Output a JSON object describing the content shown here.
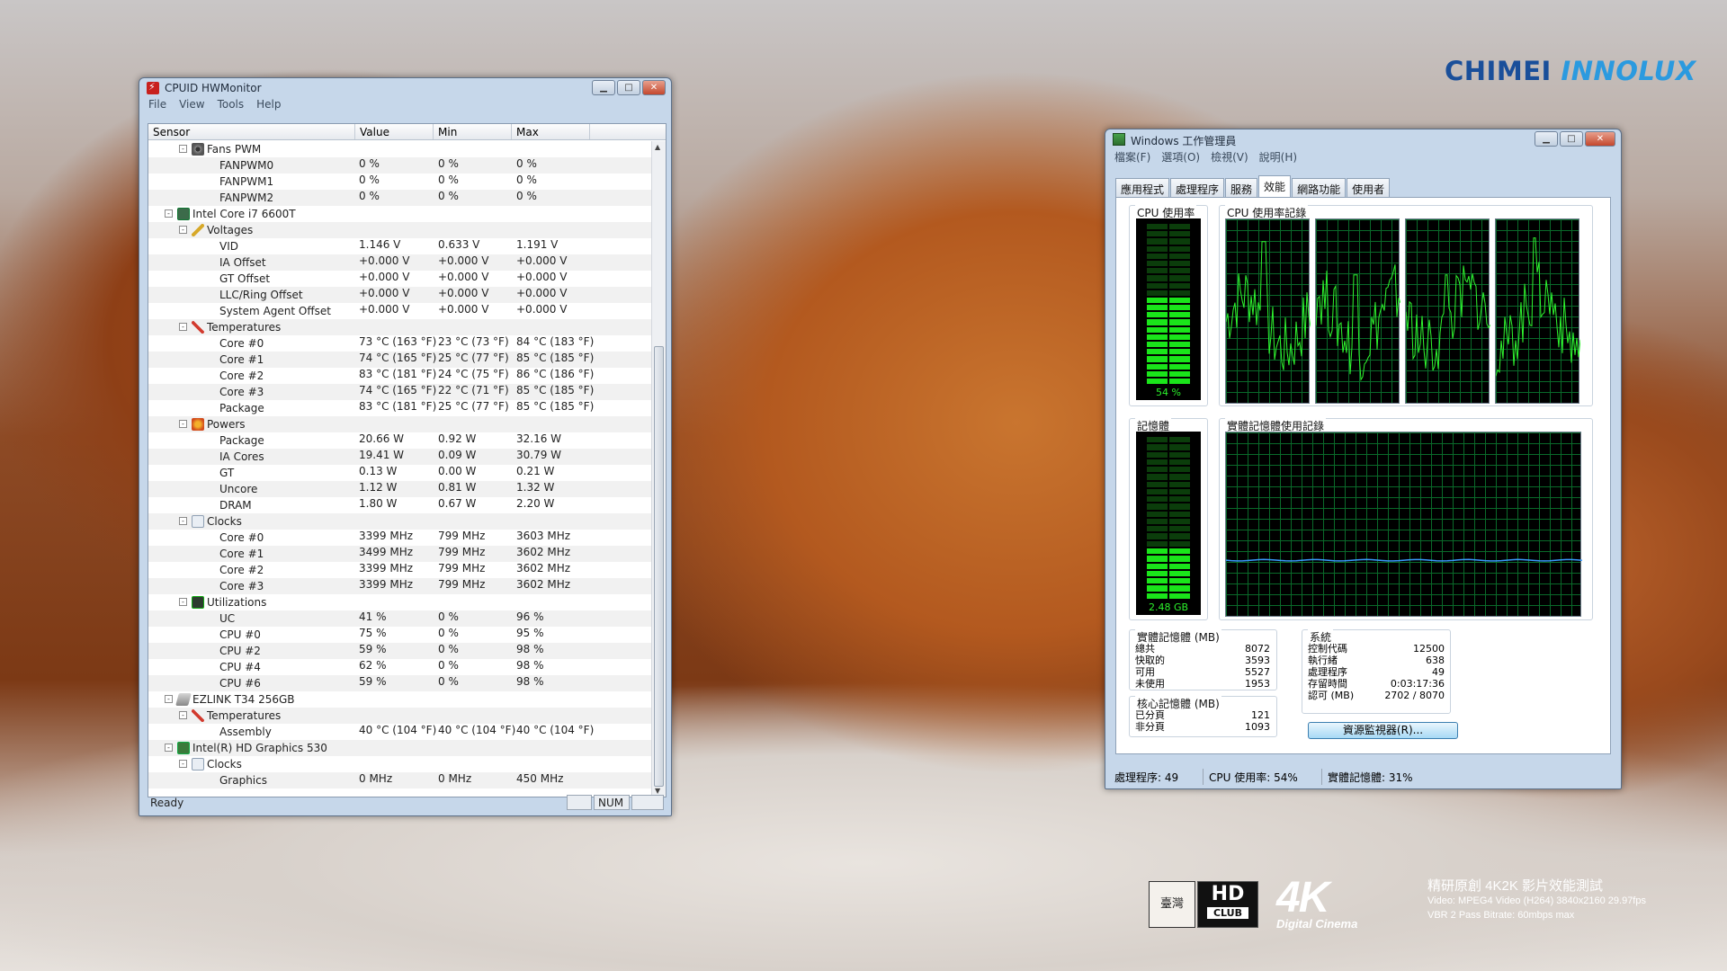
{
  "watermark": {
    "brand_part1": "CHIMEI",
    "brand_part2": "INNOLUX",
    "taiwan_badge": "臺灣",
    "hd_text": "HD",
    "club_text": "CLUB",
    "fourk_big": "4K",
    "fourk_small": "Digital Cinema",
    "line1": "精研原創 4K2K 影片效能測試",
    "line2": "Video: MPEG4 Video (H264) 3840x2160 29.97fps",
    "line3": "VBR 2 Pass Bitrate: 60mbps max"
  },
  "hwmonitor": {
    "title": "CPUID HWMonitor",
    "menu": [
      "File",
      "View",
      "Tools",
      "Help"
    ],
    "columns": [
      "Sensor",
      "Value",
      "Min",
      "Max"
    ],
    "rows": [
      {
        "level": 2,
        "toggle": "-",
        "icon": "fan",
        "name": "Fans PWM",
        "value": "",
        "min": "",
        "max": ""
      },
      {
        "level": 3,
        "name": "FANPWM0",
        "value": "0 %",
        "min": "0 %",
        "max": "0 %"
      },
      {
        "level": 3,
        "name": "FANPWM1",
        "value": "0 %",
        "min": "0 %",
        "max": "0 %"
      },
      {
        "level": 3,
        "name": "FANPWM2",
        "value": "0 %",
        "min": "0 %",
        "max": "0 %"
      },
      {
        "level": 1,
        "toggle": "-",
        "icon": "cpu",
        "name": "Intel Core i7 6600T",
        "value": "",
        "min": "",
        "max": ""
      },
      {
        "level": 2,
        "toggle": "-",
        "icon": "volt",
        "name": "Voltages",
        "value": "",
        "min": "",
        "max": ""
      },
      {
        "level": 3,
        "name": "VID",
        "value": "1.146 V",
        "min": "0.633 V",
        "max": "1.191 V"
      },
      {
        "level": 3,
        "name": "IA Offset",
        "value": "+0.000 V",
        "min": "+0.000 V",
        "max": "+0.000 V"
      },
      {
        "level": 3,
        "name": "GT Offset",
        "value": "+0.000 V",
        "min": "+0.000 V",
        "max": "+0.000 V"
      },
      {
        "level": 3,
        "name": "LLC/Ring Offset",
        "value": "+0.000 V",
        "min": "+0.000 V",
        "max": "+0.000 V"
      },
      {
        "level": 3,
        "name": "System Agent Offset",
        "value": "+0.000 V",
        "min": "+0.000 V",
        "max": "+0.000 V"
      },
      {
        "level": 2,
        "toggle": "-",
        "icon": "temp",
        "name": "Temperatures",
        "value": "",
        "min": "",
        "max": ""
      },
      {
        "level": 3,
        "name": "Core #0",
        "value": "73 °C  (163 °F)",
        "min": "23 °C  (73 °F)",
        "max": "84 °C  (183 °F)"
      },
      {
        "level": 3,
        "name": "Core #1",
        "value": "74 °C  (165 °F)",
        "min": "25 °C  (77 °F)",
        "max": "85 °C  (185 °F)"
      },
      {
        "level": 3,
        "name": "Core #2",
        "value": "83 °C  (181 °F)",
        "min": "24 °C  (75 °F)",
        "max": "86 °C  (186 °F)"
      },
      {
        "level": 3,
        "name": "Core #3",
        "value": "74 °C  (165 °F)",
        "min": "22 °C  (71 °F)",
        "max": "85 °C  (185 °F)"
      },
      {
        "level": 3,
        "name": "Package",
        "value": "83 °C  (181 °F)",
        "min": "25 °C  (77 °F)",
        "max": "85 °C  (185 °F)"
      },
      {
        "level": 2,
        "toggle": "-",
        "icon": "power",
        "name": "Powers",
        "value": "",
        "min": "",
        "max": ""
      },
      {
        "level": 3,
        "name": "Package",
        "value": "20.66 W",
        "min": "0.92 W",
        "max": "32.16 W"
      },
      {
        "level": 3,
        "name": "IA Cores",
        "value": "19.41 W",
        "min": "0.09 W",
        "max": "30.79 W"
      },
      {
        "level": 3,
        "name": "GT",
        "value": "0.13 W",
        "min": "0.00 W",
        "max": "0.21 W"
      },
      {
        "level": 3,
        "name": "Uncore",
        "value": "1.12 W",
        "min": "0.81 W",
        "max": "1.32 W"
      },
      {
        "level": 3,
        "name": "DRAM",
        "value": "1.80 W",
        "min": "0.67 W",
        "max": "2.20 W"
      },
      {
        "level": 2,
        "toggle": "-",
        "icon": "clock",
        "name": "Clocks",
        "value": "",
        "min": "",
        "max": ""
      },
      {
        "level": 3,
        "name": "Core #0",
        "value": "3399 MHz",
        "min": "799 MHz",
        "max": "3603 MHz"
      },
      {
        "level": 3,
        "name": "Core #1",
        "value": "3499 MHz",
        "min": "799 MHz",
        "max": "3602 MHz"
      },
      {
        "level": 3,
        "name": "Core #2",
        "value": "3399 MHz",
        "min": "799 MHz",
        "max": "3602 MHz"
      },
      {
        "level": 3,
        "name": "Core #3",
        "value": "3399 MHz",
        "min": "799 MHz",
        "max": "3602 MHz"
      },
      {
        "level": 2,
        "toggle": "-",
        "icon": "util",
        "name": "Utilizations",
        "value": "",
        "min": "",
        "max": ""
      },
      {
        "level": 3,
        "name": "UC",
        "value": "41 %",
        "min": "0 %",
        "max": "96 %"
      },
      {
        "level": 3,
        "name": "CPU #0",
        "value": "75 %",
        "min": "0 %",
        "max": "95 %"
      },
      {
        "level": 3,
        "name": "CPU #2",
        "value": "59 %",
        "min": "0 %",
        "max": "98 %"
      },
      {
        "level": 3,
        "name": "CPU #4",
        "value": "62 %",
        "min": "0 %",
        "max": "98 %"
      },
      {
        "level": 3,
        "name": "CPU #6",
        "value": "59 %",
        "min": "0 %",
        "max": "98 %"
      },
      {
        "level": 1,
        "toggle": "-",
        "icon": "disk",
        "name": "EZLINK T34 256GB",
        "value": "",
        "min": "",
        "max": ""
      },
      {
        "level": 2,
        "toggle": "-",
        "icon": "temp",
        "name": "Temperatures",
        "value": "",
        "min": "",
        "max": ""
      },
      {
        "level": 3,
        "name": "Assembly",
        "value": "40 °C  (104 °F)",
        "min": "40 °C  (104 °F)",
        "max": "40 °C  (104 °F)"
      },
      {
        "level": 1,
        "toggle": "-",
        "icon": "gpu",
        "name": "Intel(R) HD Graphics 530",
        "value": "",
        "min": "",
        "max": ""
      },
      {
        "level": 2,
        "toggle": "-",
        "icon": "clock",
        "name": "Clocks",
        "value": "",
        "min": "",
        "max": ""
      },
      {
        "level": 3,
        "name": "Graphics",
        "value": "0 MHz",
        "min": "0 MHz",
        "max": "450 MHz"
      }
    ],
    "status_text": "Ready",
    "status_num": "NUM"
  },
  "taskmgr": {
    "title": "Windows 工作管理員",
    "menu": [
      "檔案(F)",
      "選項(O)",
      "檢視(V)",
      "說明(H)"
    ],
    "tabs": [
      "應用程式",
      "處理程序",
      "服務",
      "效能",
      "網路功能",
      "使用者"
    ],
    "active_tab": 3,
    "cpu_usage_title": "CPU 使用率",
    "cpu_usage_label": "54 %",
    "cpu_usage_fraction": 0.54,
    "cpu_history_title": "CPU 使用率記錄",
    "mem_title": "記憶體",
    "mem_label": "2.48 GB",
    "mem_fraction": 0.31,
    "mem_history_title": "實體記憶體使用記錄",
    "physical_title": "實體記憶體 (MB)",
    "physical": [
      {
        "label": "總共",
        "value": "8072"
      },
      {
        "label": "快取的",
        "value": "3593"
      },
      {
        "label": "可用",
        "value": "5527"
      },
      {
        "label": "未使用",
        "value": "1953"
      }
    ],
    "kernel_title": "核心記憶體 (MB)",
    "kernel": [
      {
        "label": "已分頁",
        "value": "121"
      },
      {
        "label": "非分頁",
        "value": "1093"
      }
    ],
    "system_title": "系統",
    "system": [
      {
        "label": "控制代碼",
        "value": "12500"
      },
      {
        "label": "執行緒",
        "value": "638"
      },
      {
        "label": "處理程序",
        "value": "49"
      },
      {
        "label": "存留時間",
        "value": "0:03:17:36"
      },
      {
        "label": "認可 (MB)",
        "value": "2702 / 8070"
      }
    ],
    "resource_button": "資源監視器(R)...",
    "status": [
      "處理程序: 49",
      "CPU 使用率: 54%",
      "實體記憶體: 31%"
    ],
    "colors": {
      "meter_on": "#1ae51a",
      "cpu_line": "#2ff52f",
      "mem_line": "#3a9bff"
    }
  }
}
